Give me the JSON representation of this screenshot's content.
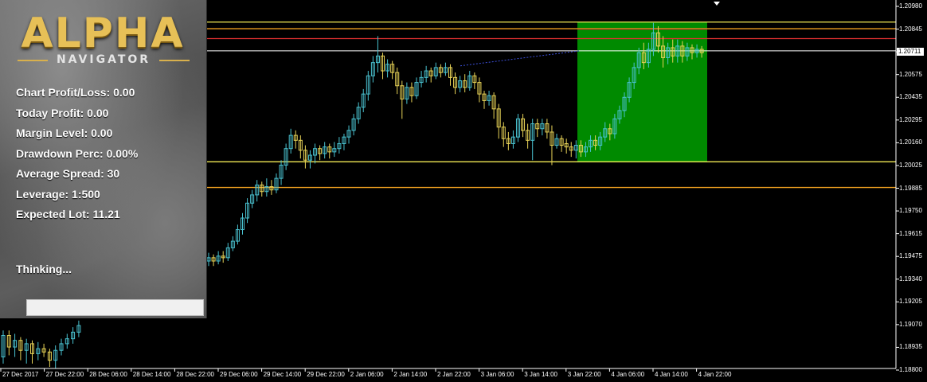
{
  "panel": {
    "logo_title": "ALPHA",
    "logo_subtitle": "NAVIGATOR",
    "chart_profit_loss": "Chart Profit/Loss: 0.00",
    "today_profit": "Today Profit: 0.00",
    "margin_level": "Margin Level: 0.00",
    "drawdown_perc": "Drawdown Perc: 0.00%",
    "average_spread": "Average Spread: 30",
    "leverage": "Leverage: 1:500",
    "expected_lot": "Expected Lot: 11.21",
    "status": "Thinking..."
  },
  "price_axis": [
    "1.20980",
    "1.20845",
    "1.20711",
    "1.20575",
    "1.20435",
    "1.20295",
    "1.20160",
    "1.20025",
    "1.19885",
    "1.19750",
    "1.19615",
    "1.19475",
    "1.19340",
    "1.19205",
    "1.19070",
    "1.18935",
    "1.18800"
  ],
  "current_price": "1.20711",
  "time_axis": [
    "27 Dec 2017",
    "27 Dec 22:00",
    "28 Dec 06:00",
    "28 Dec 14:00",
    "28 Dec 22:00",
    "29 Dec 06:00",
    "29 Dec 14:00",
    "29 Dec 22:00",
    "2 Jan 06:00",
    "2 Jan 14:00",
    "2 Jan 22:00",
    "3 Jan 06:00",
    "3 Jan 14:00",
    "3 Jan 22:00",
    "4 Jan 06:00",
    "4 Jan 14:00",
    "4 Jan 22:00"
  ],
  "colors": {
    "bull_candle": "#49c1cf",
    "bear_candle": "#e8d357",
    "highlight_zone": "#008a00",
    "yellow_level": "#f2ea55",
    "orange_level": "#f0a020",
    "red_level": "#e03030",
    "white_level": "#ffffff",
    "background": "#000000"
  },
  "chart_data": {
    "type": "candlestick",
    "symbol_price_range": [
      1.188,
      1.2098
    ],
    "levels": [
      1.20885,
      1.20845,
      1.20785,
      1.20711,
      1.2004,
      1.19885
    ],
    "highlight_zone": {
      "from": "3 Jan 22:00",
      "to": "4 Jan 22:00",
      "low": 1.2004,
      "high": 1.20885
    },
    "candles": [
      [
        1.1886,
        1.1899,
        1.1882,
        1.1902
      ],
      [
        1.1899,
        1.1892,
        1.1887,
        1.1902
      ],
      [
        1.1892,
        1.1896,
        1.1886,
        1.19
      ],
      [
        1.1896,
        1.189,
        1.1884,
        1.1898
      ],
      [
        1.189,
        1.1894,
        1.1882,
        1.1897
      ],
      [
        1.1894,
        1.1888,
        1.1882,
        1.1896
      ],
      [
        1.1888,
        1.1891,
        1.1884,
        1.1895
      ],
      [
        1.1891,
        1.1889,
        1.1886,
        1.1894
      ],
      [
        1.1889,
        1.1884,
        1.188,
        1.1891
      ],
      [
        1.1884,
        1.189,
        1.1879,
        1.1893
      ],
      [
        1.189,
        1.1894,
        1.1887,
        1.1897
      ],
      [
        1.1894,
        1.1897,
        1.1891,
        1.19
      ],
      [
        1.1897,
        1.1901,
        1.1894,
        1.1904
      ],
      [
        1.1901,
        1.1905,
        1.1898,
        1.1908
      ],
      [
        1.1944,
        1.1946,
        1.1941,
        1.1949
      ],
      [
        1.1946,
        1.1944,
        1.1941,
        1.1948
      ],
      [
        1.1944,
        1.1947,
        1.1942,
        1.195
      ],
      [
        1.1947,
        1.1946,
        1.1943,
        1.195
      ],
      [
        1.1946,
        1.1952,
        1.1944,
        1.1955
      ],
      [
        1.1952,
        1.1956,
        1.195,
        1.1959
      ],
      [
        1.1956,
        1.1963,
        1.1954,
        1.1966
      ],
      [
        1.1963,
        1.197,
        1.196,
        1.1973
      ],
      [
        1.197,
        1.1979,
        1.1967,
        1.1982
      ],
      [
        1.1979,
        1.1984,
        1.1976,
        1.1987
      ],
      [
        1.1984,
        1.199,
        1.198,
        1.1993
      ],
      [
        1.199,
        1.1986,
        1.1983,
        1.1992
      ],
      [
        1.1986,
        1.1989,
        1.1983,
        1.1994
      ],
      [
        1.1989,
        1.1987,
        1.1984,
        1.1993
      ],
      [
        1.1987,
        1.1994,
        1.1985,
        1.1997
      ],
      [
        1.1994,
        1.2002,
        1.199,
        1.2005
      ],
      [
        1.2002,
        1.2012,
        1.1999,
        1.2015
      ],
      [
        1.2012,
        1.202,
        1.2009,
        1.2024
      ],
      [
        1.202,
        1.2017,
        1.2012,
        1.2023
      ],
      [
        1.2017,
        1.2011,
        1.2006,
        1.202
      ],
      [
        1.2011,
        1.2005,
        1.2,
        1.2014
      ],
      [
        1.2005,
        1.2008,
        1.2,
        1.2011
      ],
      [
        1.2008,
        1.2012,
        1.2003,
        1.2015
      ],
      [
        1.2012,
        1.2009,
        1.2005,
        1.2014
      ],
      [
        1.2009,
        1.2013,
        1.2006,
        1.2016
      ],
      [
        1.2013,
        1.201,
        1.2006,
        1.2015
      ],
      [
        1.201,
        1.2012,
        1.2007,
        1.2016
      ],
      [
        1.2012,
        1.2015,
        1.2009,
        1.2019
      ],
      [
        1.2015,
        1.2019,
        1.2011,
        1.2021
      ],
      [
        1.2019,
        1.2023,
        1.2015,
        1.2026
      ],
      [
        1.2023,
        1.203,
        1.202,
        1.2033
      ],
      [
        1.203,
        1.2037,
        1.2027,
        1.204
      ],
      [
        1.2037,
        1.2045,
        1.2034,
        1.2048
      ],
      [
        1.2045,
        1.2056,
        1.2041,
        1.2059
      ],
      [
        1.2056,
        1.2064,
        1.2052,
        1.2068
      ],
      [
        1.2064,
        1.2068,
        1.2058,
        1.208
      ],
      [
        1.2068,
        1.2059,
        1.2054,
        1.207
      ],
      [
        1.2059,
        1.2063,
        1.2055,
        1.2066
      ],
      [
        1.2063,
        1.2058,
        1.2054,
        1.2065
      ],
      [
        1.2058,
        1.205,
        1.2045,
        1.2061
      ],
      [
        1.205,
        1.2042,
        1.203,
        1.2053
      ],
      [
        1.2042,
        1.2049,
        1.2039,
        1.2052
      ],
      [
        1.2049,
        1.2044,
        1.204,
        1.2052
      ],
      [
        1.2044,
        1.2052,
        1.2042,
        1.2055
      ],
      [
        1.2052,
        1.2055,
        1.2049,
        1.2059
      ],
      [
        1.2055,
        1.2059,
        1.2052,
        1.2062
      ],
      [
        1.2059,
        1.2056,
        1.2052,
        1.2061
      ],
      [
        1.2056,
        1.2061,
        1.2054,
        1.2064
      ],
      [
        1.2061,
        1.2058,
        1.2055,
        1.2063
      ],
      [
        1.2058,
        1.2061,
        1.2056,
        1.2064
      ],
      [
        1.2061,
        1.2055,
        1.205,
        1.2063
      ],
      [
        1.2055,
        1.2049,
        1.2045,
        1.2058
      ],
      [
        1.2049,
        1.2053,
        1.2046,
        1.2056
      ],
      [
        1.2053,
        1.2049,
        1.2046,
        1.2057
      ],
      [
        1.2049,
        1.2056,
        1.2047,
        1.2059
      ],
      [
        1.2056,
        1.2052,
        1.2048,
        1.2058
      ],
      [
        1.2052,
        1.2045,
        1.204,
        1.2055
      ],
      [
        1.2045,
        1.2041,
        1.2036,
        1.2047
      ],
      [
        1.2041,
        1.2044,
        1.2038,
        1.2047
      ],
      [
        1.2044,
        1.2036,
        1.203,
        1.2046
      ],
      [
        1.2036,
        1.2025,
        1.2018,
        1.2039
      ],
      [
        1.2025,
        1.2018,
        1.2013,
        1.2028
      ],
      [
        1.2018,
        1.2015,
        1.2011,
        1.2022
      ],
      [
        1.2015,
        1.2019,
        1.2012,
        1.2023
      ],
      [
        1.2019,
        1.203,
        1.2016,
        1.2033
      ],
      [
        1.203,
        1.2023,
        1.2019,
        1.2033
      ],
      [
        1.2023,
        1.2017,
        1.2012,
        1.2027
      ],
      [
        1.2017,
        1.2027,
        1.2005,
        1.203
      ],
      [
        1.2027,
        1.2024,
        1.2019,
        1.203
      ],
      [
        1.2024,
        1.2027,
        1.202,
        1.203
      ],
      [
        1.2027,
        1.2022,
        1.2018,
        1.203
      ],
      [
        1.2022,
        1.2014,
        1.2002,
        1.2026
      ],
      [
        1.2014,
        1.2018,
        1.2012,
        1.2021
      ],
      [
        1.2018,
        1.2014,
        1.201,
        1.202
      ],
      [
        1.2015,
        1.2013,
        1.2009,
        1.2018
      ],
      [
        1.2013,
        1.2011,
        1.2007,
        1.2016
      ],
      [
        1.2011,
        1.2014,
        1.2006,
        1.2017
      ],
      [
        1.2014,
        1.201,
        1.2007,
        1.2017
      ],
      [
        1.201,
        1.2013,
        1.2007,
        1.2016
      ],
      [
        1.2013,
        1.2017,
        1.201,
        1.202
      ],
      [
        1.2017,
        1.2014,
        1.2011,
        1.202
      ],
      [
        1.2014,
        1.2019,
        1.2011,
        1.2022
      ],
      [
        1.2019,
        1.2024,
        1.2016,
        1.2028
      ],
      [
        1.2024,
        1.2021,
        1.2017,
        1.2027
      ],
      [
        1.2021,
        1.203,
        1.2018,
        1.2033
      ],
      [
        1.203,
        1.2035,
        1.2027,
        1.2038
      ],
      [
        1.2035,
        1.2043,
        1.2031,
        1.2046
      ],
      [
        1.2043,
        1.2052,
        1.204,
        1.2055
      ],
      [
        1.2052,
        1.2061,
        1.2048,
        1.2064
      ],
      [
        1.2061,
        1.207,
        1.2057,
        1.2073
      ],
      [
        1.207,
        1.2064,
        1.206,
        1.2076
      ],
      [
        1.2064,
        1.2072,
        1.2061,
        1.2076
      ],
      [
        1.2072,
        1.2082,
        1.2068,
        1.2088
      ],
      [
        1.2082,
        1.2074,
        1.207,
        1.2086
      ],
      [
        1.2074,
        1.2067,
        1.2061,
        1.208
      ],
      [
        1.2067,
        1.2073,
        1.2063,
        1.2076
      ],
      [
        1.2073,
        1.2068,
        1.2064,
        1.2078
      ],
      [
        1.2068,
        1.2074,
        1.2064,
        1.2078
      ],
      [
        1.2074,
        1.2068,
        1.2064,
        1.2077
      ],
      [
        1.2068,
        1.2073,
        1.2065,
        1.2076
      ],
      [
        1.2073,
        1.207,
        1.2066,
        1.2075
      ],
      [
        1.207,
        1.2072,
        1.2067,
        1.2075
      ],
      [
        1.2072,
        1.207,
        1.2067,
        1.2074
      ]
    ]
  }
}
